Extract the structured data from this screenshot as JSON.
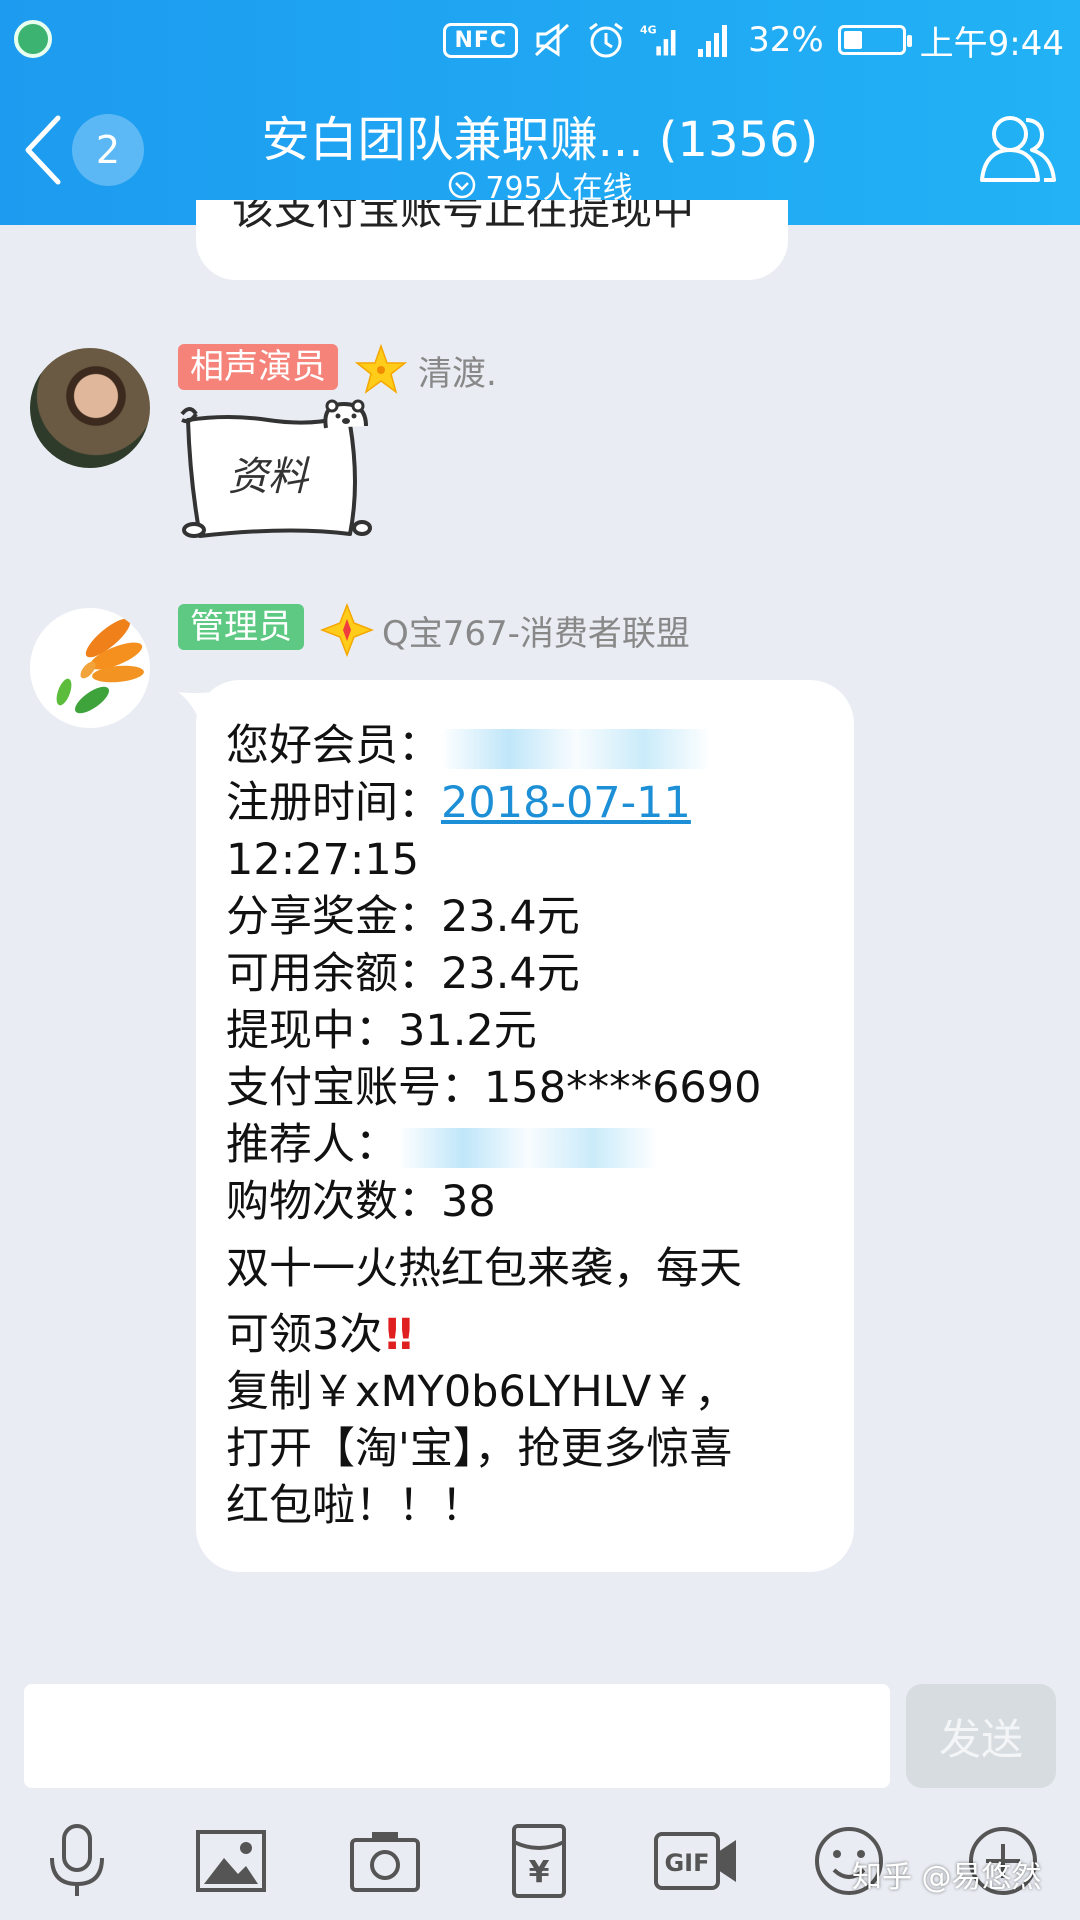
{
  "status_bar": {
    "nfc": "NFC",
    "network": "4G",
    "battery": "32%",
    "battery_level": 0.32,
    "time": "上午9:44"
  },
  "header": {
    "back_badge": "2",
    "title": "安白团队兼职赚... (1356)",
    "online": "795人在线"
  },
  "messages": {
    "partial_text": "该支付宝账号正在提现中",
    "msg1": {
      "tag": "相声演员",
      "sender": "清渡.",
      "sticker_text": "资料"
    },
    "msg2": {
      "tag": "管理员",
      "sender": "Q宝767-消费者联盟",
      "lines": {
        "member_label": "您好会员：",
        "reg_label": "注册时间：",
        "reg_date": "2018-07-11",
        "reg_time": "12:27:15",
        "share_bonus": "分享奖金：23.4元",
        "balance": "可用余额：23.4元",
        "withdrawing": "提现中：31.2元",
        "alipay": "支付宝账号：158****6690",
        "referrer_label": "推荐人：",
        "purchase_count": "购物次数：38",
        "promo_1": "双十一火热红包来袭，每天",
        "promo_2": "可领3次",
        "promo_2_emoji": "!!",
        "promo_3": "复制￥xMY0b6LYHLV￥，",
        "promo_4": "打开【淘'宝】，抢更多惊喜",
        "promo_5": "红包啦！！！"
      }
    }
  },
  "input": {
    "send_label": "发送"
  },
  "toolbar": {
    "icons": [
      "microphone-icon",
      "image-icon",
      "camera-icon",
      "red-packet-icon",
      "gif-icon",
      "emoji-icon",
      "plus-icon"
    ],
    "gif_label": "GIF",
    "red_packet_label": "¥"
  },
  "watermark": "知乎 @易悠然",
  "colors": {
    "header_blue": "#1d9bf0",
    "tag_red": "#f6837a",
    "tag_green": "#5dc982",
    "link": "#1c8fd6"
  }
}
